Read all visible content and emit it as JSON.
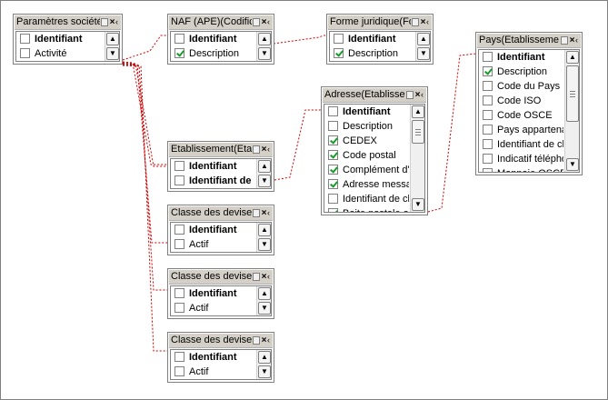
{
  "window": {
    "tables": [
      {
        "title": "Paramètres société(",
        "fields": [
          {
            "label": "Identifiant",
            "checked": false,
            "bold": true
          },
          {
            "label": "Activité",
            "checked": false,
            "bold": false
          }
        ]
      },
      {
        "title": "NAF (APE)(Codificat",
        "fields": [
          {
            "label": "Identifiant",
            "checked": false,
            "bold": true
          },
          {
            "label": "Description",
            "checked": true,
            "bold": false
          }
        ]
      },
      {
        "title": "Forme juridique(For",
        "fields": [
          {
            "label": "Identifiant",
            "checked": false,
            "bold": true
          },
          {
            "label": "Description",
            "checked": true,
            "bold": false
          }
        ]
      },
      {
        "title": "Adresse(Etablissem",
        "fields": [
          {
            "label": "Identifiant",
            "checked": false,
            "bold": true
          },
          {
            "label": "Description",
            "checked": false,
            "bold": false
          },
          {
            "label": "CEDEX",
            "checked": true,
            "bold": false
          },
          {
            "label": "Code postal",
            "checked": true,
            "bold": false
          },
          {
            "label": "Complément d'a",
            "checked": true,
            "bold": false
          },
          {
            "label": "Adresse messag",
            "checked": true,
            "bold": false
          },
          {
            "label": "Identifiant de cla",
            "checked": false,
            "bold": false
          },
          {
            "label": "Boite postale ou",
            "checked": true,
            "bold": false
          }
        ]
      },
      {
        "title": "Pays(Etablisseme",
        "fields": [
          {
            "label": "Identifiant",
            "checked": false,
            "bold": true
          },
          {
            "label": "Description",
            "checked": true,
            "bold": false
          },
          {
            "label": "Code du Pays",
            "checked": false,
            "bold": false
          },
          {
            "label": "Code ISO",
            "checked": false,
            "bold": false
          },
          {
            "label": "Code OSCE",
            "checked": false,
            "bold": false
          },
          {
            "label": "Pays appartenan",
            "checked": false,
            "bold": false
          },
          {
            "label": "Identifiant de cla",
            "checked": false,
            "bold": false
          },
          {
            "label": "Indicatif télépho",
            "checked": false,
            "bold": false
          },
          {
            "label": "Monnaie OSCE",
            "checked": false,
            "bold": false
          }
        ]
      },
      {
        "title": "Etablissement(Etab",
        "fields": [
          {
            "label": "Identifiant",
            "checked": false,
            "bold": true
          },
          {
            "label": "Identifiant de",
            "checked": false,
            "bold": true
          }
        ]
      },
      {
        "title": "Classe des devises(",
        "fields": [
          {
            "label": "Identifiant",
            "checked": false,
            "bold": true
          },
          {
            "label": "Actif",
            "checked": false,
            "bold": false
          }
        ]
      },
      {
        "title": "Classe des devises(",
        "fields": [
          {
            "label": "Identifiant",
            "checked": false,
            "bold": true
          },
          {
            "label": "Actif",
            "checked": false,
            "bold": false
          }
        ]
      },
      {
        "title": "Classe des devises(",
        "fields": [
          {
            "label": "Identifiant",
            "checked": false,
            "bold": true
          },
          {
            "label": "Actif",
            "checked": false,
            "bold": false
          }
        ]
      }
    ]
  },
  "icons": {
    "minimize": "minimize-icon",
    "close": "close-icon",
    "scroll_up": "scroll-up-arrow-icon",
    "scroll_down": "scroll-down-arrow-icon"
  },
  "colors": {
    "link_line": "#cc0000",
    "check_mark": "#1a9a2a",
    "title_bar": "#d4d0c8"
  }
}
